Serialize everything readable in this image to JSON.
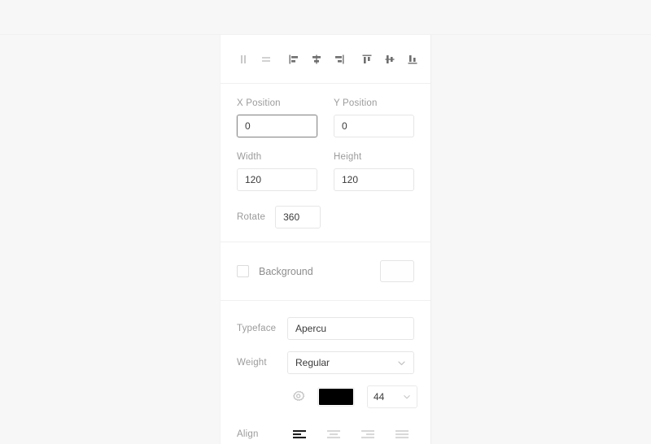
{
  "panel": {
    "align_toolbar": {
      "buttons": [
        {
          "name": "align-vertical-center-distribute-icon",
          "title": "Distribute vertical centers"
        },
        {
          "name": "align-horizontal-distribute-icon",
          "title": "Distribute horizontal"
        },
        {
          "name": "align-left-icon",
          "title": "Align left"
        },
        {
          "name": "align-center-horizontal-icon",
          "title": "Align horizontal centers"
        },
        {
          "name": "align-right-icon",
          "title": "Align right"
        },
        {
          "name": "align-top-icon",
          "title": "Align top"
        },
        {
          "name": "align-middle-vertical-icon",
          "title": "Align vertical centers"
        },
        {
          "name": "align-bottom-icon",
          "title": "Align bottom"
        }
      ]
    },
    "transform": {
      "x_position_label": "X Position",
      "x_position_value": "0",
      "y_position_label": "Y Position",
      "y_position_value": "0",
      "width_label": "Width",
      "width_value": "120",
      "height_label": "Height",
      "height_value": "120",
      "rotate_label": "Rotate",
      "rotate_value": "360"
    },
    "background": {
      "label": "Background",
      "checked": false,
      "swatch_color": "#fefefe"
    },
    "typography": {
      "typeface_label": "Typeface",
      "typeface_value": "Apercu",
      "weight_label": "Weight",
      "weight_value": "Regular",
      "weight_options": [
        "Regular"
      ],
      "settings_icon": "gear-icon",
      "text_color": "#000000",
      "font_size_value": "44",
      "font_size_options": [
        "44"
      ],
      "align_label": "Align",
      "align_buttons": [
        {
          "name": "text-align-left-icon",
          "active": true
        },
        {
          "name": "text-align-center-icon",
          "active": false
        },
        {
          "name": "text-align-right-icon",
          "active": false
        },
        {
          "name": "text-align-justify-icon",
          "active": false
        }
      ]
    }
  }
}
